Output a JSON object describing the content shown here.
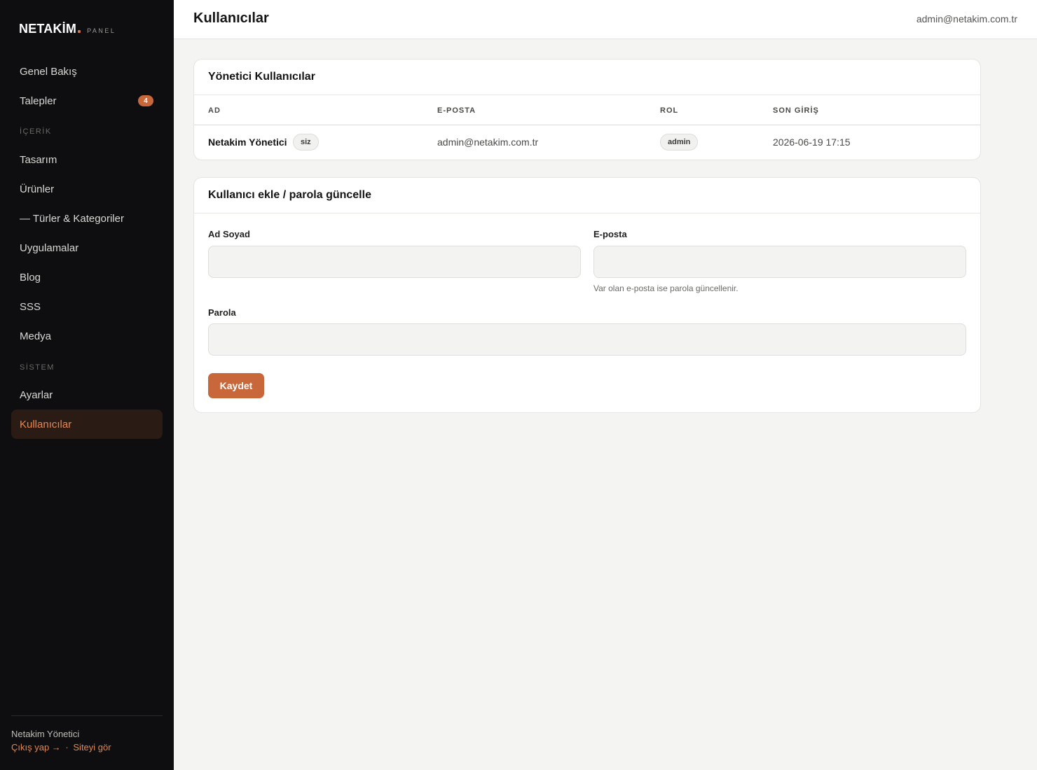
{
  "sidebar": {
    "brand": "NETAKİM",
    "brand_sub": "PANEL",
    "items": [
      {
        "label": "Genel Bakış"
      },
      {
        "label": "Talepler",
        "badge": "4"
      },
      {
        "label": "Tasarım"
      },
      {
        "label": "Ürünler"
      },
      {
        "label": "— Türler & Kategoriler"
      },
      {
        "label": "Uygulamalar"
      },
      {
        "label": "Blog"
      },
      {
        "label": "SSS"
      },
      {
        "label": "Medya"
      },
      {
        "label": "Ayarlar"
      },
      {
        "label": "Kullanıcılar"
      }
    ],
    "sections": {
      "content": "İÇERİK",
      "system": "SİSTEM"
    },
    "footer": {
      "user": "Netakim Yönetici",
      "logout": "Çıkış yap →",
      "separator": "·",
      "view_site": "Siteyi gör"
    },
    "active_color": "#e8864e"
  },
  "header": {
    "title": "Kullanıcılar",
    "email": "admin@netakim.com.tr"
  },
  "users_card": {
    "title": "Yönetici Kullanıcılar",
    "columns": [
      "AD",
      "E-POSTA",
      "ROL",
      "SON GİRİŞ"
    ],
    "rows": [
      {
        "name": "Netakim Yönetici",
        "tag": "siz",
        "email": "admin@netakim.com.tr",
        "role": "admin",
        "last_login": "2026-06-19 17:15"
      }
    ]
  },
  "form_card": {
    "title": "Kullanıcı ekle / parola güncelle",
    "name_label": "Ad Soyad",
    "name_value": "",
    "email_label": "E-posta",
    "email_value": "",
    "email_hint": "Var olan e-posta ise parola güncellenir.",
    "password_label": "Parola",
    "password_value": "",
    "save_label": "Kaydet"
  },
  "colors": {
    "accent": "#c8683a",
    "sidebar_bg": "#0e0e10",
    "page_bg": "#f4f4f2"
  }
}
